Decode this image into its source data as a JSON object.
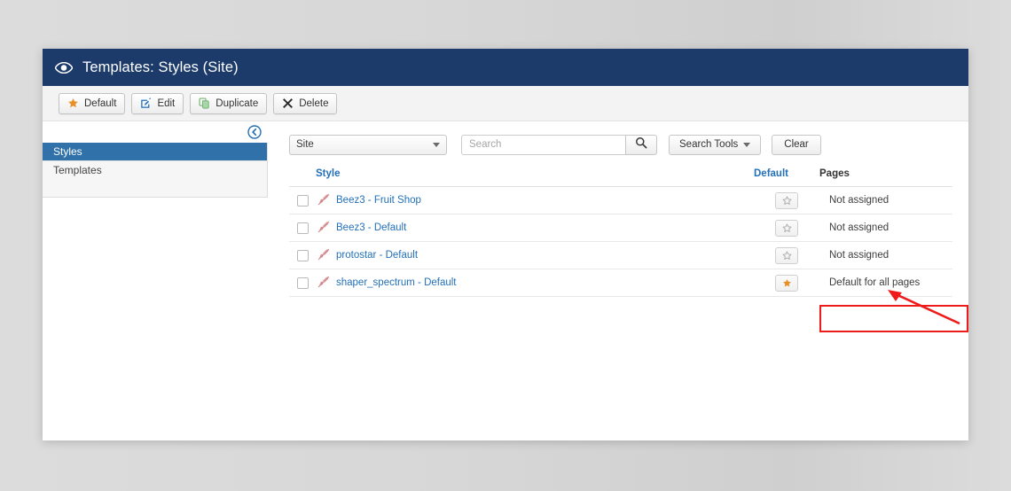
{
  "header": {
    "icon": "eye-icon",
    "title": "Templates: Styles (Site)",
    "background": "#1c3b6b"
  },
  "toolbar": {
    "buttons": [
      {
        "label": "Default",
        "icon": "star-icon",
        "icon_color": "#e8912a"
      },
      {
        "label": "Edit",
        "icon": "pencil-square-icon",
        "icon_color": "#2370b8"
      },
      {
        "label": "Duplicate",
        "icon": "copy-icon",
        "icon_color": "#7cb87c"
      },
      {
        "label": "Delete",
        "icon": "x-mark-icon",
        "icon_color": "#2b2b2b"
      }
    ]
  },
  "sidebar": {
    "collapse_icon": "circle-arrow-left-icon",
    "items": [
      {
        "label": "Styles",
        "active": true
      },
      {
        "label": "Templates",
        "active": false
      }
    ],
    "active_color": "#3071a9"
  },
  "filters": {
    "site_select": {
      "value": "Site",
      "icon": "chevron-down-icon"
    },
    "search": {
      "value": "",
      "placeholder": "Search",
      "button_icon": "search-icon"
    },
    "search_tools": {
      "label": "Search Tools",
      "icon": "chevron-down-icon"
    },
    "clear": {
      "label": "Clear"
    }
  },
  "table": {
    "columns": {
      "style": "Style",
      "default": "Default",
      "pages": "Pages"
    },
    "rows": [
      {
        "checked": false,
        "icon": "paint-brush-icon",
        "style": "Beez3 - Fruit Shop",
        "is_default": false,
        "pages": "Not assigned"
      },
      {
        "checked": false,
        "icon": "paint-brush-icon",
        "style": "Beez3 - Default",
        "is_default": false,
        "pages": "Not assigned"
      },
      {
        "checked": false,
        "icon": "paint-brush-icon",
        "style": "protostar - Default",
        "is_default": false,
        "pages": "Not assigned"
      },
      {
        "checked": false,
        "icon": "paint-brush-icon",
        "style": "shaper_spectrum - Default",
        "is_default": true,
        "pages": "Default for all pages"
      }
    ]
  },
  "annotations": {
    "highlight_color": "#ef1b1b",
    "arrow_color": "#ef1b1b",
    "target": "Default for all pages"
  },
  "colors": {
    "link": "#2370b8",
    "star_active": "#e8912a",
    "star_inactive": "#b9b9b9",
    "style_icon": "#d98f92"
  }
}
